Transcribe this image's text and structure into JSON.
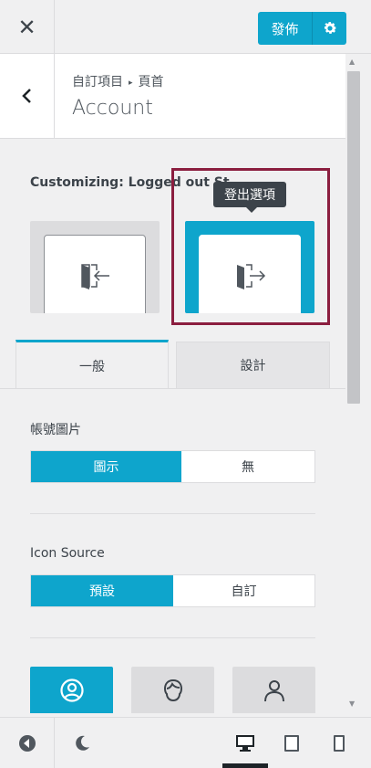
{
  "toolbar": {
    "close_icon": "✕",
    "publish_label": "發佈",
    "settings_icon": "gear-icon"
  },
  "header": {
    "breadcrumb_parent": "自訂項目",
    "breadcrumb_sep": "▸",
    "breadcrumb_current": "頁首",
    "title": "Account"
  },
  "state": {
    "label": "Customizing: Logged out St",
    "tooltip": "登出選項",
    "options": [
      {
        "name": "login-state",
        "icon": "login-icon",
        "selected": false
      },
      {
        "name": "logout-state",
        "icon": "logout-icon",
        "selected": true
      }
    ]
  },
  "tabs": {
    "general": "一般",
    "design": "設計"
  },
  "account_image": {
    "label": "帳號圖片",
    "options": [
      "圖示",
      "無"
    ],
    "selected": "圖示"
  },
  "icon_source": {
    "label": "Icon Source",
    "options": [
      "預設",
      "自訂"
    ],
    "selected": "預設"
  },
  "icon_choices": [
    "user-circle-icon",
    "user-avatar-icon",
    "user-outline-icon"
  ],
  "footer": {
    "collapse_icon": "collapse-icon",
    "dark_mode_icon": "moon-icon",
    "devices": [
      "desktop-icon",
      "tablet-icon",
      "mobile-icon"
    ],
    "active_device": "desktop-icon"
  },
  "colors": {
    "accent": "#0ea5cc",
    "highlight": "#8b1e3f",
    "tooltip_bg": "#3c434a"
  }
}
